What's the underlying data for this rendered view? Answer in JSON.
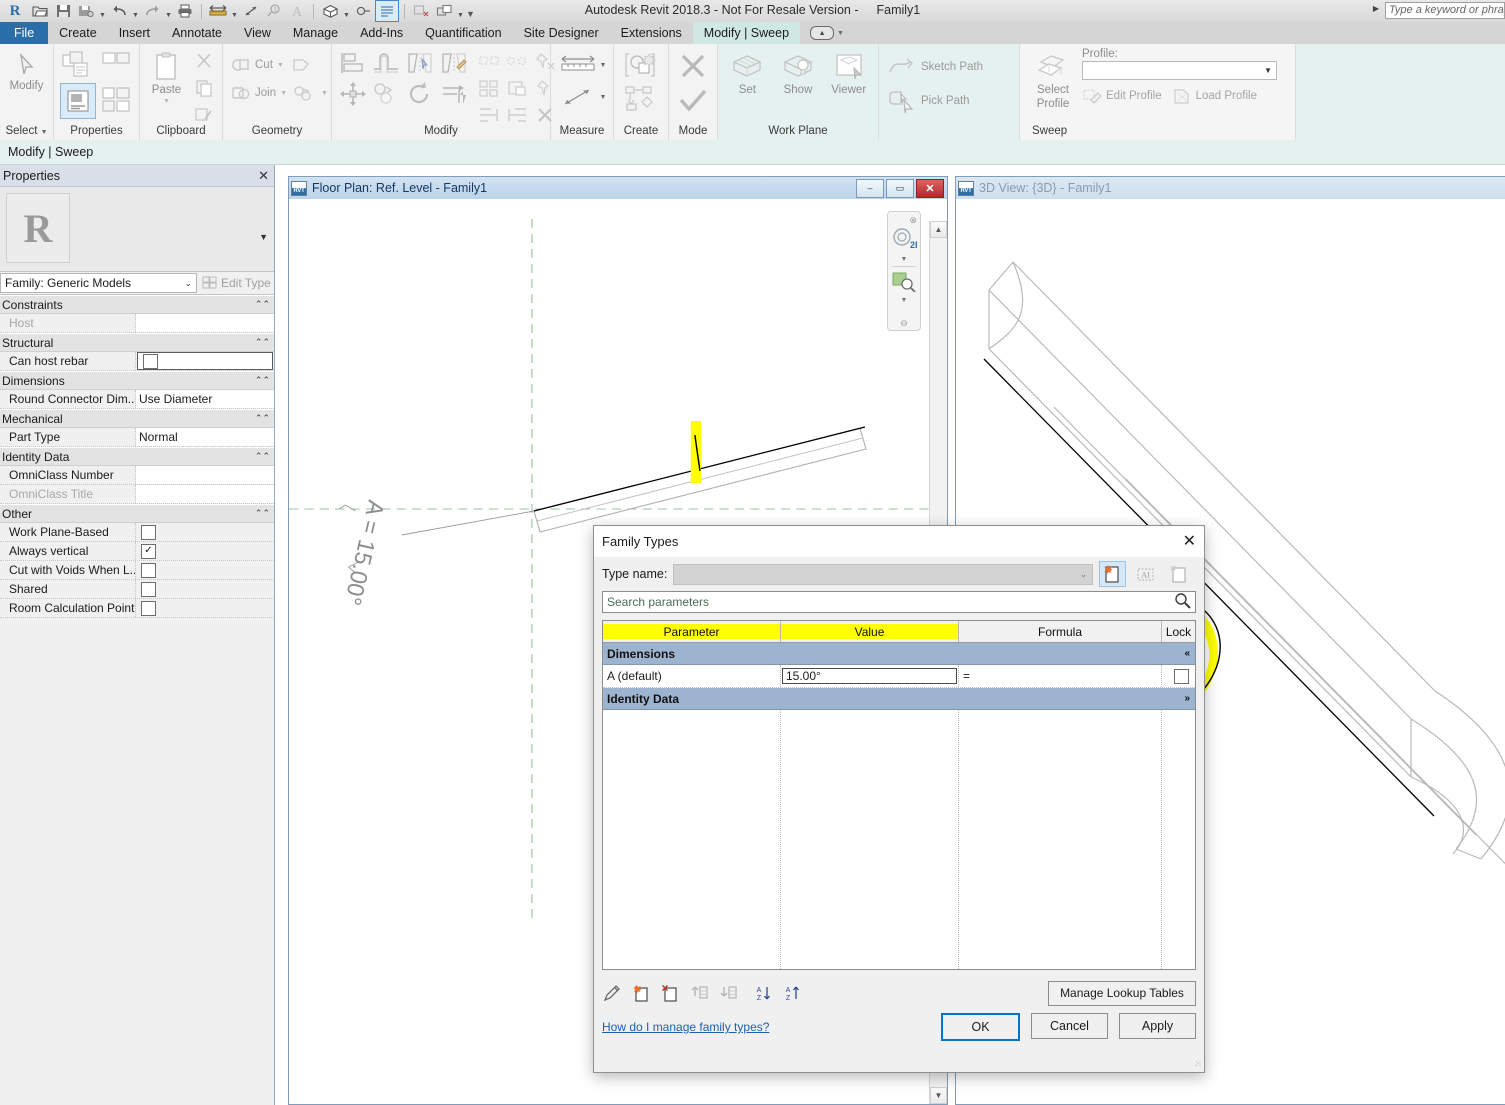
{
  "app": {
    "title": "Autodesk Revit 2018.3 - Not For Resale Version -",
    "document": "Family1",
    "search_placeholder": "Type a keyword or phrase",
    "context_bar": "Modify | Sweep"
  },
  "quick_access": {
    "icons": [
      "revit-logo",
      "open-icon",
      "save-icon",
      "save-as-icon",
      "undo-icon",
      "redo-icon",
      "print-icon",
      "measure-icon",
      "aligned-dimension-icon",
      "tag-icon",
      "text-icon",
      "default-3d-view-icon",
      "section-icon",
      "thin-lines-icon",
      "close-hidden-windows-icon",
      "switch-windows-icon"
    ]
  },
  "ribbon": {
    "tabs": [
      {
        "label": "File",
        "state": "file"
      },
      {
        "label": "Create",
        "state": "normal"
      },
      {
        "label": "Insert",
        "state": "normal"
      },
      {
        "label": "Annotate",
        "state": "normal"
      },
      {
        "label": "View",
        "state": "normal"
      },
      {
        "label": "Manage",
        "state": "normal"
      },
      {
        "label": "Add-Ins",
        "state": "normal"
      },
      {
        "label": "Quantification",
        "state": "normal"
      },
      {
        "label": "Site Designer",
        "state": "normal"
      },
      {
        "label": "Extensions",
        "state": "normal"
      },
      {
        "label": "Modify | Sweep",
        "state": "active"
      }
    ],
    "panels": {
      "select": {
        "label": "Select",
        "modify_label": "Modify"
      },
      "properties": {
        "label": "Properties"
      },
      "clipboard": {
        "label": "Clipboard",
        "paste_label": "Paste"
      },
      "geometry": {
        "label": "Geometry",
        "cut_label": "Cut",
        "join_label": "Join"
      },
      "modify": {
        "label": "Modify"
      },
      "measure": {
        "label": "Measure"
      },
      "create": {
        "label": "Create"
      },
      "mode": {
        "label": "Mode"
      },
      "workplane": {
        "label": "Work Plane",
        "set_label": "Set",
        "show_label": "Show",
        "viewer_label": "Viewer",
        "sketch_path_label": "Sketch Path",
        "pick_path_label": "Pick Path"
      },
      "sweep": {
        "label": "Sweep",
        "select_profile_label_1": "Select",
        "select_profile_label_2": "Profile",
        "profile_caption": "Profile:",
        "profile_value": "",
        "edit_profile_label": "Edit Profile",
        "load_profile_label": "Load Profile"
      }
    }
  },
  "properties_palette": {
    "header": "Properties",
    "close_icon": "✕",
    "type_selector": "Family: Generic Models",
    "edit_type_label": "Edit Type",
    "groups": [
      {
        "name": "Constraints",
        "rows": [
          {
            "name": "Host",
            "value": "",
            "kind": "text",
            "disabled": true
          }
        ]
      },
      {
        "name": "Structural",
        "rows": [
          {
            "name": "Can host rebar",
            "value": "",
            "kind": "checkbox",
            "checked": false,
            "focused": true
          }
        ]
      },
      {
        "name": "Dimensions",
        "rows": [
          {
            "name": "Round Connector Dim...",
            "value": "Use Diameter",
            "kind": "text"
          }
        ]
      },
      {
        "name": "Mechanical",
        "rows": [
          {
            "name": "Part Type",
            "value": "Normal",
            "kind": "text"
          }
        ]
      },
      {
        "name": "Identity Data",
        "rows": [
          {
            "name": "OmniClass Number",
            "value": "",
            "kind": "text"
          },
          {
            "name": "OmniClass Title",
            "value": "",
            "kind": "text",
            "disabled": true
          }
        ]
      },
      {
        "name": "Other",
        "rows": [
          {
            "name": "Work Plane-Based",
            "value": "",
            "kind": "checkbox",
            "checked": false
          },
          {
            "name": "Always vertical",
            "value": "",
            "kind": "checkbox",
            "checked": true
          },
          {
            "name": "Cut with Voids When L...",
            "value": "",
            "kind": "checkbox",
            "checked": false
          },
          {
            "name": "Shared",
            "value": "",
            "kind": "checkbox",
            "checked": false
          },
          {
            "name": "Room Calculation Point",
            "value": "",
            "kind": "checkbox",
            "checked": false
          }
        ]
      }
    ]
  },
  "views": {
    "plan": {
      "title": "Floor Plan: Ref. Level - Family1",
      "minimize_label": "–",
      "restore_label": "▭",
      "close_label": "✕",
      "dimension_annotation": "A = 15.00°"
    },
    "three_d": {
      "title": "3D View: {3D} - Family1"
    }
  },
  "dialog": {
    "title": "Family Types",
    "close_icon": "✕",
    "type_name_label": "Type name:",
    "type_name_value": "",
    "new_type_icon": "new-type-icon",
    "rename_type_icon": "rename-type-icon",
    "delete_type_icon": "delete-type-icon",
    "search_placeholder": "Search parameters",
    "search_icon": "search-icon",
    "columns": [
      {
        "label": "Parameter",
        "highlighted": true
      },
      {
        "label": "Value",
        "highlighted": true
      },
      {
        "label": "Formula",
        "highlighted": false
      },
      {
        "label": "Lock",
        "highlighted": false
      }
    ],
    "rows": [
      {
        "type": "group",
        "label": "Dimensions",
        "chevron": "«"
      },
      {
        "type": "param",
        "parameter": "A (default)",
        "value": "15.00°",
        "formula": "=",
        "lock": false
      },
      {
        "type": "group",
        "label": "Identity Data",
        "chevron": "»"
      }
    ],
    "toolbar_icons": [
      "edit-parameter-icon",
      "new-parameter-icon",
      "remove-parameter-icon",
      "move-up-icon",
      "move-down-icon",
      "sort-ascending-icon",
      "sort-descending-icon"
    ],
    "manage_lookup_tables_label": "Manage Lookup Tables",
    "help_link": "How do I manage family types?",
    "ok_label": "OK",
    "cancel_label": "Cancel",
    "apply_label": "Apply"
  },
  "colors": {
    "accent_blue": "#2a6ea8",
    "tab_active": "#cfe8e4",
    "highlight_yellow": "#ffff00",
    "group_header_blue": "#9db4d0",
    "title_bar_blue": "#bcd4ea",
    "ref_plane_green": "#9dc39d"
  }
}
